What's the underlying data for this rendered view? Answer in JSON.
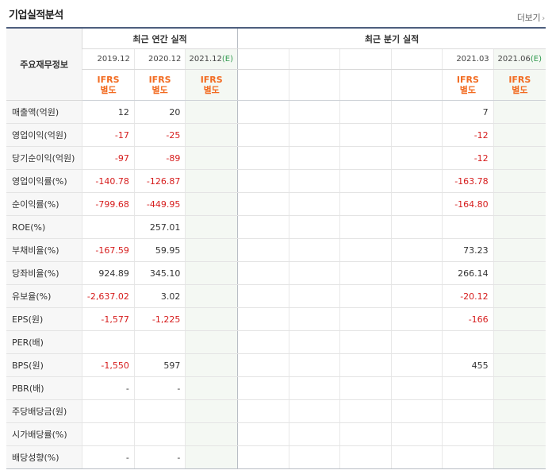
{
  "header": {
    "title": "기업실적분석",
    "more_label": "더보기",
    "more_icon": "chevron-right-icon"
  },
  "table": {
    "row_header_label": "주요재무정보",
    "annual_group_label": "최근 연간 실적",
    "quarter_group_label": "최근 분기 실적",
    "annual_periods": [
      "2019.12",
      "2020.12",
      "2021.12"
    ],
    "annual_estimate_suffix": "(E)",
    "quarter_periods": [
      "",
      "",
      "",
      "",
      "2021.03",
      "2021.06"
    ],
    "quarter_estimate_suffix": "(E)",
    "standard_top": "IFRS",
    "standard_bottom": "별도",
    "rows": [
      {
        "label": "매출액(억원)",
        "annual": [
          "12",
          "20",
          ""
        ],
        "quarter": [
          "",
          "",
          "",
          "",
          "7",
          ""
        ]
      },
      {
        "label": "영업이익(억원)",
        "annual": [
          "-17",
          "-25",
          ""
        ],
        "quarter": [
          "",
          "",
          "",
          "",
          "-12",
          ""
        ]
      },
      {
        "label": "당기순이익(억원)",
        "annual": [
          "-97",
          "-89",
          ""
        ],
        "quarter": [
          "",
          "",
          "",
          "",
          "-12",
          ""
        ]
      },
      {
        "label": "영업이익률(%)",
        "annual": [
          "-140.78",
          "-126.87",
          ""
        ],
        "quarter": [
          "",
          "",
          "",
          "",
          "-163.78",
          ""
        ]
      },
      {
        "label": "순이익률(%)",
        "annual": [
          "-799.68",
          "-449.95",
          ""
        ],
        "quarter": [
          "",
          "",
          "",
          "",
          "-164.80",
          ""
        ]
      },
      {
        "label": "ROE(%)",
        "annual": [
          "",
          "257.01",
          ""
        ],
        "quarter": [
          "",
          "",
          "",
          "",
          "",
          ""
        ]
      },
      {
        "label": "부채비율(%)",
        "annual": [
          "-167.59",
          "59.95",
          ""
        ],
        "quarter": [
          "",
          "",
          "",
          "",
          "73.23",
          ""
        ]
      },
      {
        "label": "당좌비율(%)",
        "annual": [
          "924.89",
          "345.10",
          ""
        ],
        "quarter": [
          "",
          "",
          "",
          "",
          "266.14",
          ""
        ]
      },
      {
        "label": "유보율(%)",
        "annual": [
          "-2,637.02",
          "3.02",
          ""
        ],
        "quarter": [
          "",
          "",
          "",
          "",
          "-20.12",
          ""
        ]
      },
      {
        "label": "EPS(원)",
        "annual": [
          "-1,577",
          "-1,225",
          ""
        ],
        "quarter": [
          "",
          "",
          "",
          "",
          "-166",
          ""
        ]
      },
      {
        "label": "PER(배)",
        "annual": [
          "",
          "",
          ""
        ],
        "quarter": [
          "",
          "",
          "",
          "",
          "",
          ""
        ]
      },
      {
        "label": "BPS(원)",
        "annual": [
          "-1,550",
          "597",
          ""
        ],
        "quarter": [
          "",
          "",
          "",
          "",
          "455",
          ""
        ]
      },
      {
        "label": "PBR(배)",
        "annual": [
          "-",
          "-",
          ""
        ],
        "quarter": [
          "",
          "",
          "",
          "",
          "",
          ""
        ]
      },
      {
        "label": "주당배당금(원)",
        "annual": [
          "",
          "",
          ""
        ],
        "quarter": [
          "",
          "",
          "",
          "",
          "",
          ""
        ]
      },
      {
        "label": "시가배당률(%)",
        "annual": [
          "",
          "",
          ""
        ],
        "quarter": [
          "",
          "",
          "",
          "",
          "",
          ""
        ]
      },
      {
        "label": "배당성향(%)",
        "annual": [
          "-",
          "-",
          ""
        ],
        "quarter": [
          "",
          "",
          "",
          "",
          "",
          ""
        ]
      }
    ]
  },
  "colors": {
    "header_line": "#4d5e7e",
    "ifrs_orange": "#f26b21",
    "negative_red": "#d61c1c",
    "estimate_green": "#2f9a4e"
  }
}
